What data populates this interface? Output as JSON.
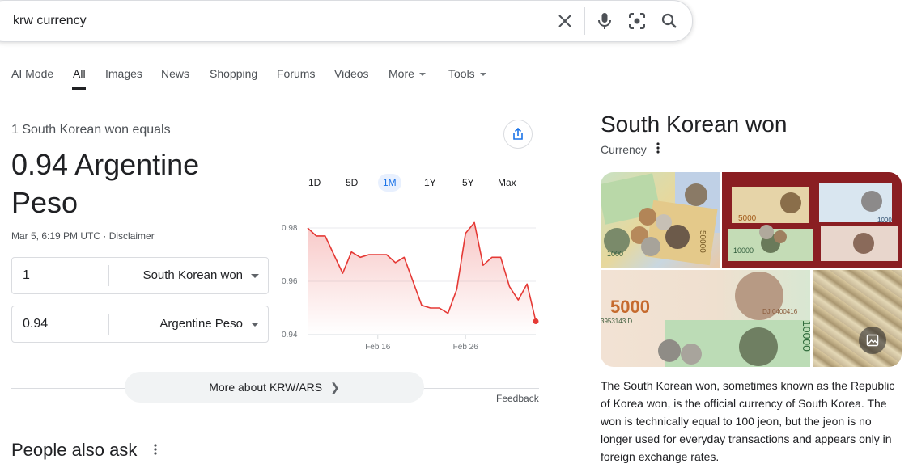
{
  "search": {
    "query": "krw currency"
  },
  "tabs": [
    {
      "label": "AI Mode"
    },
    {
      "label": "All"
    },
    {
      "label": "Images"
    },
    {
      "label": "News"
    },
    {
      "label": "Shopping"
    },
    {
      "label": "Forums"
    },
    {
      "label": "Videos"
    },
    {
      "label": "More"
    },
    {
      "label": "Tools"
    }
  ],
  "converter": {
    "equals_text": "1 South Korean won equals",
    "result_line1": "0.94 Argentine",
    "result_line2": "Peso",
    "timestamp": "Mar 5, 6:19 PM UTC",
    "separator": " · ",
    "disclaimer": "Disclaimer",
    "from_value": "1",
    "from_currency": "South Korean won",
    "to_value": "0.94",
    "to_currency": "Argentine Peso"
  },
  "ranges": [
    "1D",
    "5D",
    "1M",
    "1Y",
    "5Y",
    "Max"
  ],
  "active_range": "1M",
  "chart_data": {
    "type": "line",
    "x_tick_labels": [
      "Feb 16",
      "Feb 26"
    ],
    "y_tick_labels": [
      "0.98",
      "0.96",
      "0.94"
    ],
    "ylim": [
      0.94,
      0.98
    ],
    "line_color": "#e53935",
    "values": [
      0.98,
      0.977,
      0.977,
      0.97,
      0.963,
      0.971,
      0.969,
      0.97,
      0.97,
      0.97,
      0.967,
      0.969,
      0.96,
      0.951,
      0.95,
      0.95,
      0.948,
      0.957,
      0.978,
      0.982,
      0.966,
      0.969,
      0.969,
      0.958,
      0.953,
      0.959,
      0.945
    ]
  },
  "more_about": "More about KRW/ARS",
  "feedback": "Feedback",
  "people_also_ask": "People also ask",
  "knowledge_panel": {
    "title": "South Korean won",
    "subtitle": "Currency",
    "description": "The South Korean won, sometimes known as the Republic of Korea won, is the official currency of South Korea. The won is technically equal to 100 jeon, but the jeon is no longer used for everyday transactions and appears only in foreign exchange rates.",
    "img1_denoms": [
      "50000",
      "1000"
    ],
    "img2_denoms": [
      "5000",
      "10000",
      "1000"
    ],
    "img3_denoms": [
      "5000",
      "10000"
    ],
    "img3_small": [
      "DJ 0400416",
      "3953143 D"
    ]
  },
  "colors": {
    "accent": "#1a73e8",
    "chart_line": "#e53935"
  }
}
